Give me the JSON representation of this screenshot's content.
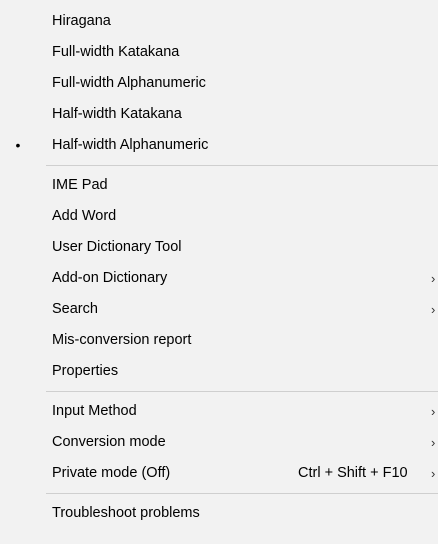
{
  "menu": {
    "items": [
      {
        "id": "hiragana",
        "label": "Hiragana",
        "selected": false,
        "submenu": false,
        "shortcut": ""
      },
      {
        "id": "full-width-katakana",
        "label": "Full-width Katakana",
        "selected": false,
        "submenu": false,
        "shortcut": ""
      },
      {
        "id": "full-width-alphanumeric",
        "label": "Full-width Alphanumeric",
        "selected": false,
        "submenu": false,
        "shortcut": ""
      },
      {
        "id": "half-width-katakana",
        "label": "Half-width Katakana",
        "selected": false,
        "submenu": false,
        "shortcut": ""
      },
      {
        "id": "half-width-alphanumeric",
        "label": "Half-width Alphanumeric",
        "selected": true,
        "submenu": false,
        "shortcut": ""
      },
      {
        "separator": true
      },
      {
        "id": "ime-pad",
        "label": "IME Pad",
        "selected": false,
        "submenu": false,
        "shortcut": ""
      },
      {
        "id": "add-word",
        "label": "Add Word",
        "selected": false,
        "submenu": false,
        "shortcut": ""
      },
      {
        "id": "user-dictionary-tool",
        "label": "User Dictionary Tool",
        "selected": false,
        "submenu": false,
        "shortcut": ""
      },
      {
        "id": "add-on-dictionary",
        "label": "Add-on Dictionary",
        "selected": false,
        "submenu": true,
        "shortcut": ""
      },
      {
        "id": "search",
        "label": "Search",
        "selected": false,
        "submenu": true,
        "shortcut": ""
      },
      {
        "id": "mis-conversion-report",
        "label": "Mis-conversion report",
        "selected": false,
        "submenu": false,
        "shortcut": ""
      },
      {
        "id": "properties",
        "label": "Properties",
        "selected": false,
        "submenu": false,
        "shortcut": ""
      },
      {
        "separator": true
      },
      {
        "id": "input-method",
        "label": "Input Method",
        "selected": false,
        "submenu": true,
        "shortcut": ""
      },
      {
        "id": "conversion-mode",
        "label": "Conversion mode",
        "selected": false,
        "submenu": true,
        "shortcut": ""
      },
      {
        "id": "private-mode",
        "label": "Private mode (Off)",
        "selected": false,
        "submenu": true,
        "shortcut": "Ctrl + Shift + F10"
      },
      {
        "separator": true
      },
      {
        "id": "troubleshoot-problems",
        "label": "Troubleshoot problems",
        "selected": false,
        "submenu": false,
        "shortcut": ""
      }
    ]
  },
  "icons": {
    "bullet": "•",
    "submenu_arrow": "›"
  },
  "colors": {
    "background": "#f2f2f2",
    "separator": "#cfcfcf",
    "text": "#000000"
  }
}
